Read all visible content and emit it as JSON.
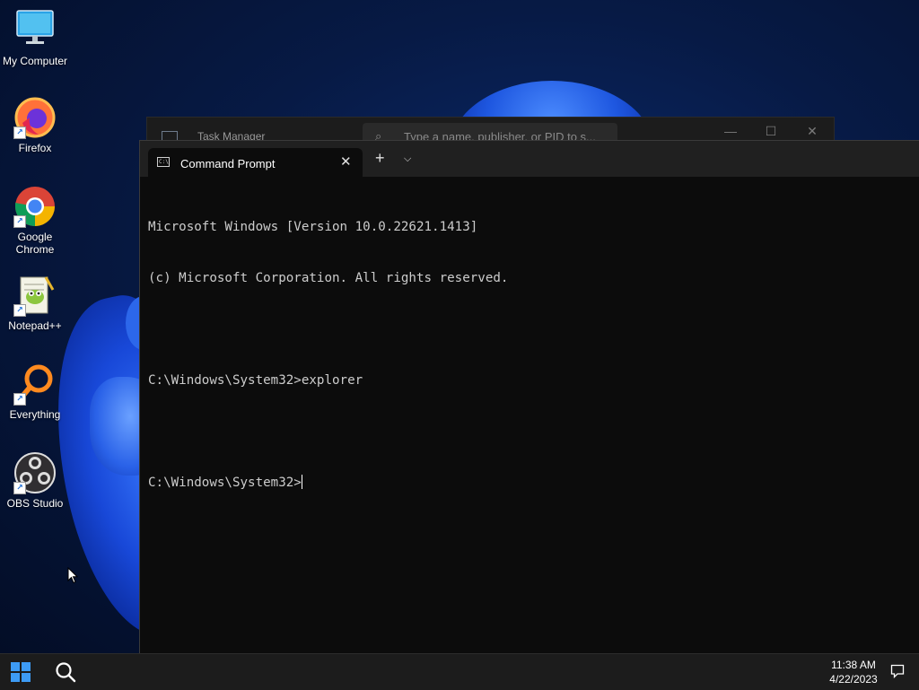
{
  "desktop": {
    "icons": [
      {
        "label": "My Computer",
        "icon": "monitor-icon"
      },
      {
        "label": "Firefox",
        "icon": "firefox-icon"
      },
      {
        "label": "Google Chrome",
        "icon": "chrome-icon"
      },
      {
        "label": "Notepad++",
        "icon": "notepadpp-icon"
      },
      {
        "label": "Everything",
        "icon": "everything-icon"
      },
      {
        "label": "OBS Studio",
        "icon": "obs-icon"
      }
    ]
  },
  "task_manager": {
    "title": "Task Manager",
    "search_placeholder": "Type a name, publisher, or PID to s...",
    "minimize": "—",
    "maximize": "☐",
    "close": "✕"
  },
  "terminal": {
    "tab_title": "Command Prompt",
    "tab_close": "✕",
    "new_tab": "+",
    "dropdown": "⌵",
    "lines": [
      "Microsoft Windows [Version 10.0.22621.1413]",
      "(c) Microsoft Corporation. All rights reserved.",
      "",
      "C:\\Windows\\System32>explorer",
      "",
      "C:\\Windows\\System32>"
    ]
  },
  "taskbar": {
    "time": "11:38 AM",
    "date": "4/22/2023"
  },
  "colors": {
    "accent": "#3d9bf5",
    "terminal_bg": "#0c0c0c",
    "taskbar_bg": "#1c1c1c"
  }
}
